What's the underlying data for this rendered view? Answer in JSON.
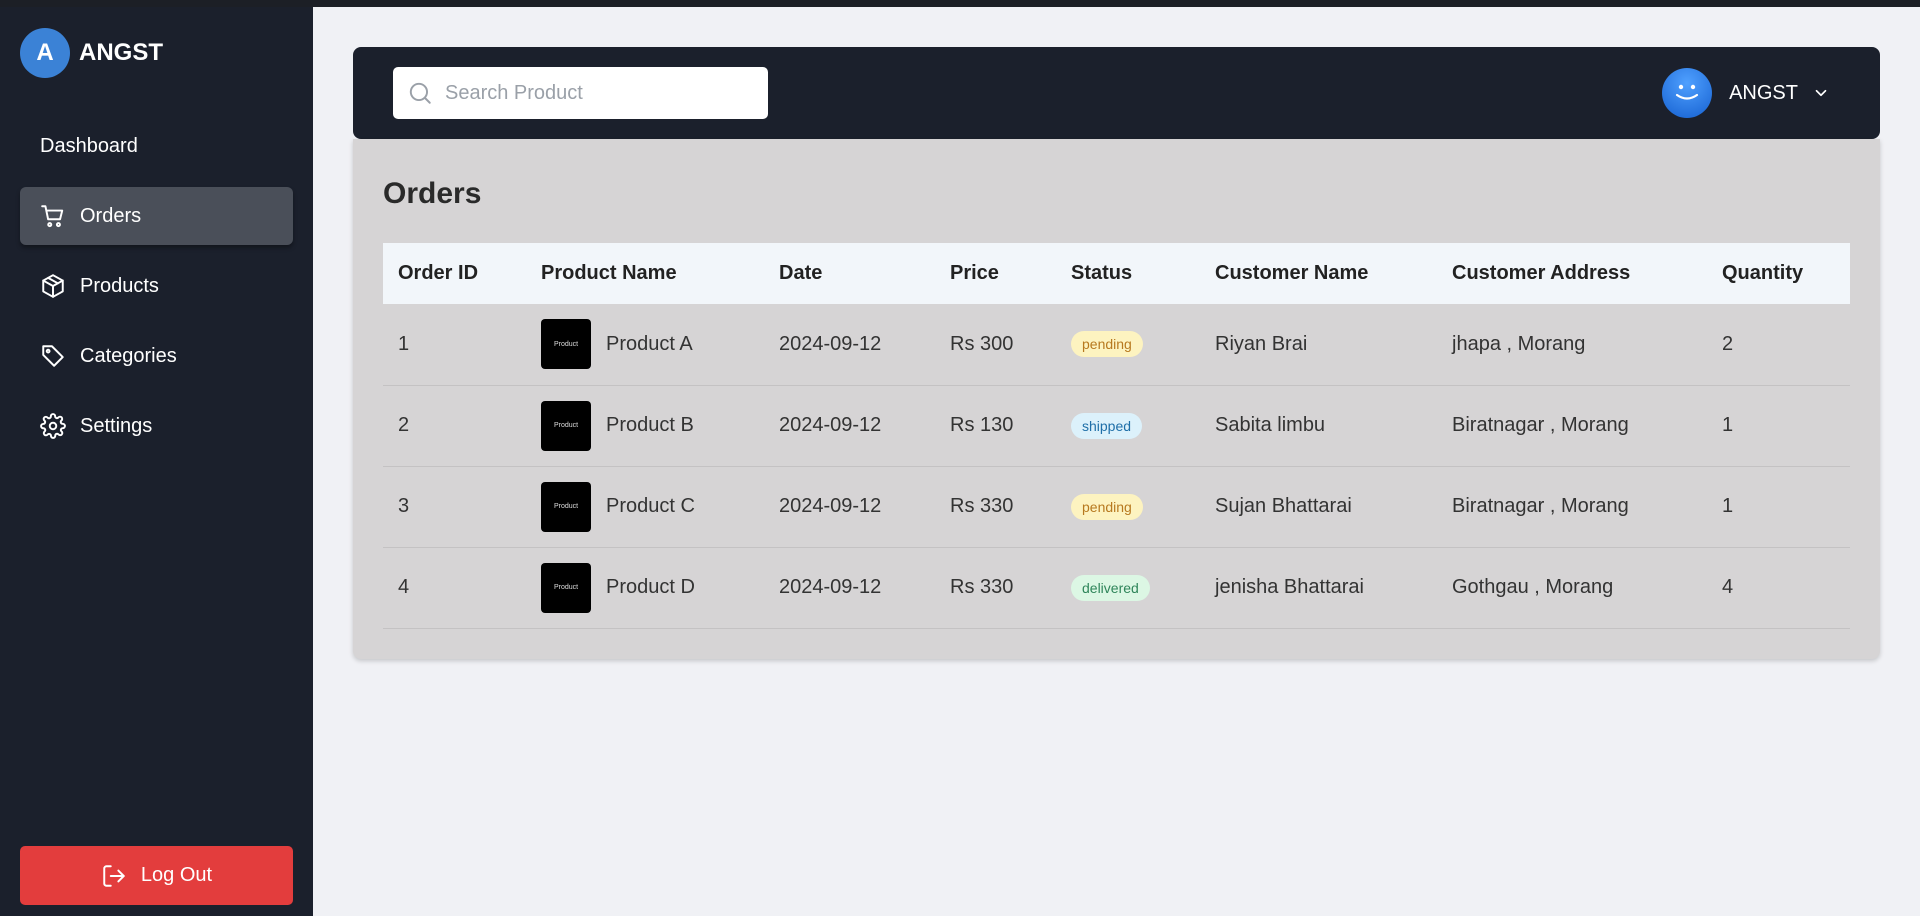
{
  "brand": {
    "initial": "A",
    "name": "ANGST"
  },
  "sidebar": {
    "items": [
      {
        "label": "Dashboard",
        "icon": "none"
      },
      {
        "label": "Orders",
        "icon": "cart-icon",
        "active": true
      },
      {
        "label": "Products",
        "icon": "box-icon"
      },
      {
        "label": "Categories",
        "icon": "tag-icon"
      },
      {
        "label": "Settings",
        "icon": "gear-icon"
      }
    ],
    "logout_label": "Log Out"
  },
  "search": {
    "placeholder": "Search Product"
  },
  "user": {
    "name": "ANGST"
  },
  "orders": {
    "title": "Orders",
    "columns": [
      "Order ID",
      "Product Name",
      "Date",
      "Price",
      "Status",
      "Customer Name",
      "Customer Address",
      "Quantity"
    ],
    "thumb_text": "Product",
    "rows": [
      {
        "id": "1",
        "product": "Product A",
        "date": "2024-09-12",
        "price": "Rs 300",
        "status": "pending",
        "customer": "Riyan Brai",
        "address": "jhapa , Morang",
        "quantity": "2"
      },
      {
        "id": "2",
        "product": "Product B",
        "date": "2024-09-12",
        "price": "Rs 130",
        "status": "shipped",
        "customer": "Sabita limbu",
        "address": "Biratnagar , Morang",
        "quantity": "1"
      },
      {
        "id": "3",
        "product": "Product C",
        "date": "2024-09-12",
        "price": "Rs 330",
        "status": "pending",
        "customer": "Sujan Bhattarai",
        "address": "Biratnagar , Morang",
        "quantity": "1"
      },
      {
        "id": "4",
        "product": "Product D",
        "date": "2024-09-12",
        "price": "Rs 330",
        "status": "delivered",
        "customer": "jenisha Bhattarai",
        "address": "Gothgau , Morang",
        "quantity": "4"
      }
    ]
  },
  "colors": {
    "sidebar_bg": "#1b202c",
    "active_item_bg": "#4a4f59",
    "logout_bg": "#e33d3d",
    "brand_avatar": "#3b82d6",
    "card_bg": "#d6d4d5"
  }
}
